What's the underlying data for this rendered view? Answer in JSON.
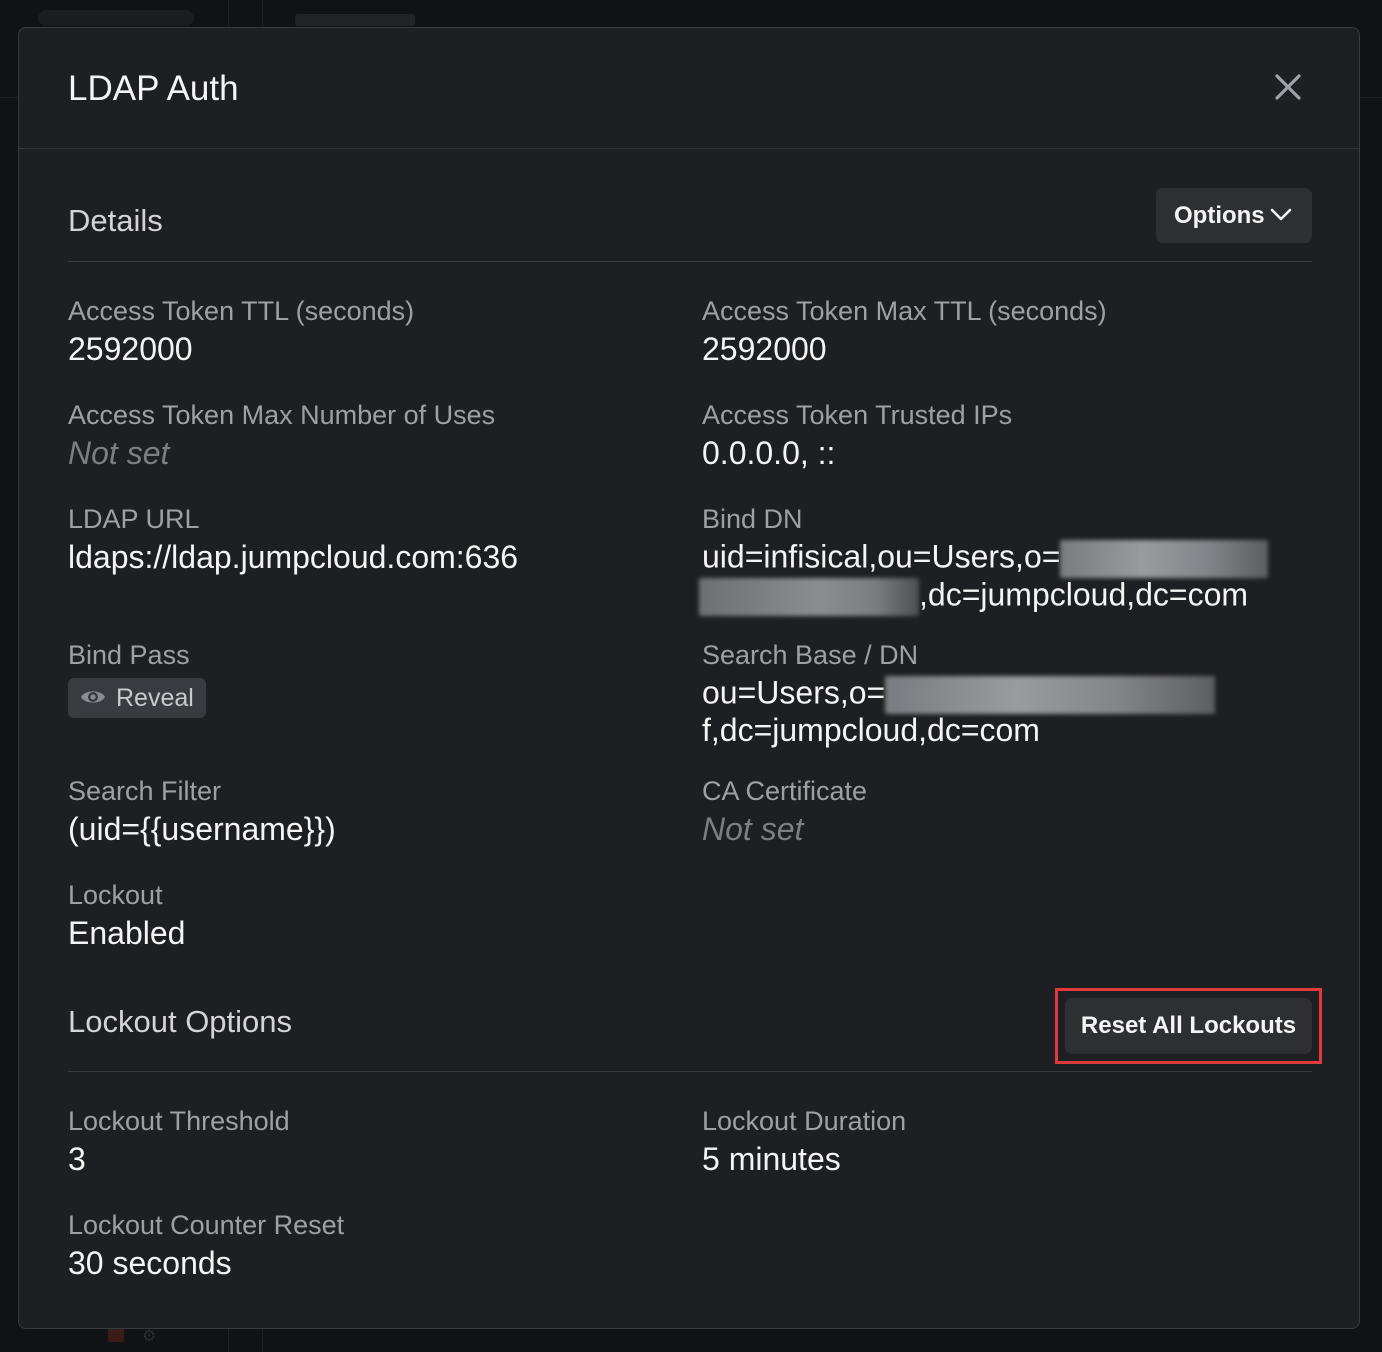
{
  "modal": {
    "title": "LDAP Auth"
  },
  "details": {
    "title": "Details",
    "options_label": "Options",
    "fields": {
      "access_token_ttl": {
        "label": "Access Token TTL (seconds)",
        "value": "2592000"
      },
      "access_token_max_ttl": {
        "label": "Access Token Max TTL (seconds)",
        "value": "2592000"
      },
      "access_token_max_uses": {
        "label": "Access Token Max Number of Uses",
        "value": "Not set"
      },
      "access_token_trusted_ips": {
        "label": "Access Token Trusted IPs",
        "value": "0.0.0.0, ::"
      },
      "ldap_url": {
        "label": "LDAP URL",
        "value": "ldaps://ldap.jumpcloud.com:636"
      },
      "bind_dn": {
        "label": "Bind DN",
        "value_line1": "uid=infisical,ou=Users,o=",
        "value_line2": ",dc=jumpcloud,dc=com"
      },
      "bind_pass": {
        "label": "Bind Pass",
        "reveal_label": "Reveal"
      },
      "search_base": {
        "label": "Search Base / DN",
        "value_line1": "ou=Users,o=",
        "value_line2": "f,dc=jumpcloud,dc=com"
      },
      "search_filter": {
        "label": "Search Filter",
        "value": "(uid={{username}})"
      },
      "ca_certificate": {
        "label": "CA Certificate",
        "value": "Not set"
      },
      "lockout": {
        "label": "Lockout",
        "value": "Enabled"
      }
    }
  },
  "lockout_options": {
    "title": "Lockout Options",
    "reset_label": "Reset All Lockouts",
    "fields": {
      "threshold": {
        "label": "Lockout Threshold",
        "value": "3"
      },
      "duration": {
        "label": "Lockout Duration",
        "value": "5 minutes"
      },
      "counter_reset": {
        "label": "Lockout Counter Reset",
        "value": "30 seconds"
      }
    }
  },
  "icons": {
    "close": "close-icon",
    "options_chevron": "chevron-down-icon",
    "reveal": "eye-icon"
  },
  "colors": {
    "modal_bg": "#1e1f22",
    "highlight": "#e03a3e",
    "button_bg": "#2e2f33"
  }
}
